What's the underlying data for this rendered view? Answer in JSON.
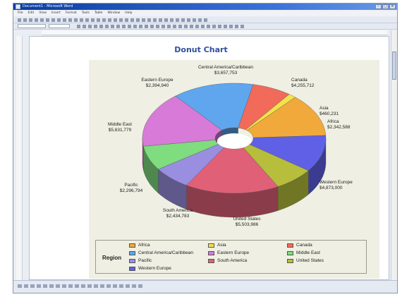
{
  "window": {
    "title": "Document1 - Microsoft Word"
  },
  "menu": [
    "File",
    "Edit",
    "View",
    "Insert",
    "Format",
    "Tools",
    "Table",
    "Window",
    "Help"
  ],
  "chart_data": {
    "type": "pie",
    "title": "Donut Chart",
    "legend_title": "Region",
    "legend_placement": "bottom",
    "hole": true,
    "three_d": true,
    "categories": [
      "Africa",
      "Asia",
      "Canada",
      "Central America/Caribbean",
      "Eastern Europe",
      "Middle East",
      "Pacific",
      "South America",
      "United States",
      "Western Europe"
    ],
    "labels": [
      {
        "name": "Canada",
        "value": "$4,255,712"
      },
      {
        "name": "Asia",
        "value": "$460,231"
      },
      {
        "name": "Africa",
        "value": "$2,342,588"
      },
      {
        "name": "Western Europe",
        "value": "$4,873,000"
      },
      {
        "name": "United States",
        "value": "$5,503,986"
      },
      {
        "name": "South America",
        "value": "$2,434,783"
      },
      {
        "name": "Pacific",
        "value": "$2,296,794"
      },
      {
        "name": "Middle East",
        "value": "$5,631,779"
      },
      {
        "name": "Eastern Europe",
        "value": "$2,394,940"
      },
      {
        "name": "Central America/Caribbean",
        "value": "$3,657,753"
      }
    ],
    "values": [
      4255712,
      460231,
      2342588,
      4873000,
      5503986,
      2434783,
      2296794,
      5631779,
      2394940,
      3657753
    ],
    "slice_order": [
      "Canada",
      "Asia",
      "Africa",
      "Western Europe",
      "United States",
      "South America",
      "Pacific",
      "Middle East",
      "Eastern Europe",
      "Central America/Caribbean"
    ],
    "colors": {
      "Africa": "#f2a93b",
      "Asia": "#f2e34a",
      "Canada": "#f26a5a",
      "Central America/Caribbean": "#5fa6ee",
      "Eastern Europe": "#d87ad8",
      "Middle East": "#7fdc7f",
      "Pacific": "#9a8ee0",
      "South America": "#e06078",
      "United States": "#b6be3c",
      "Western Europe": "#5f60e6"
    }
  }
}
